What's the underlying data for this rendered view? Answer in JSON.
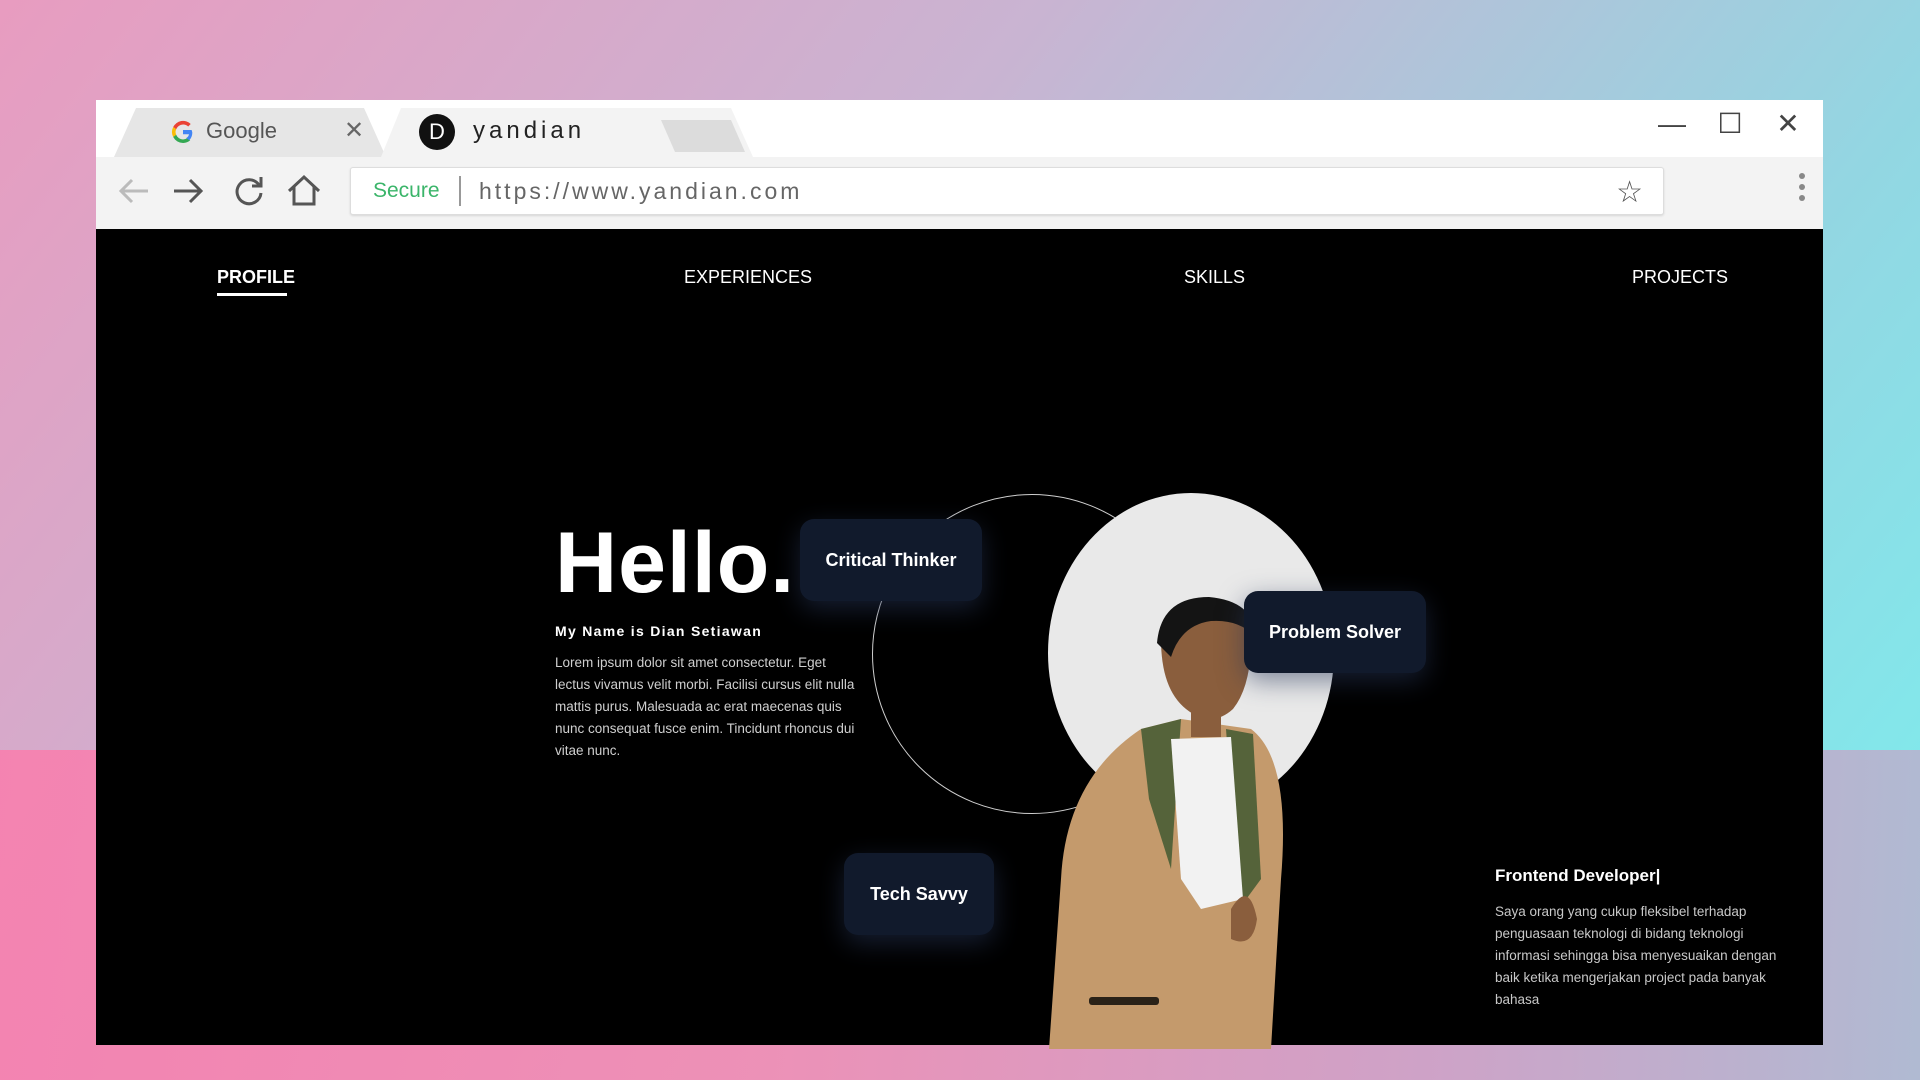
{
  "browser": {
    "tabs": [
      {
        "label": "Google",
        "close": "✕"
      },
      {
        "label": "yandian",
        "icon_letter": "D",
        "close": "✕"
      }
    ],
    "window_controls": {
      "minimize": "—",
      "maximize": "☐",
      "close": "✕"
    },
    "address": {
      "secure_label": "Secure",
      "url": "https://www.yandian.com"
    }
  },
  "nav": {
    "items": [
      "PROFILE",
      "EXPERIENCES",
      "SKILLS",
      "PROJECTS"
    ],
    "active": "PROFILE"
  },
  "hero": {
    "greeting": "Hello.",
    "name_line": "My Name is Dian Setiawan",
    "intro": "Lorem ipsum dolor sit amet consectetur. Eget lectus vivamus velit morbi. Facilisi cursus elit nulla mattis purus. Malesuada ac erat maecenas quis nunc consequat fusce enim. Tincidunt rhoncus dui vitae nunc."
  },
  "chips": [
    "Critical Thinker",
    "Problem Solver",
    "Tech Savvy"
  ],
  "role": {
    "title": "Frontend Developer|",
    "description": "Saya orang yang cukup fleksibel terhadap penguasaan teknologi di bidang teknologi informasi sehingga bisa menyesuaikan dengan baik ketika mengerjakan project pada banyak bahasa"
  },
  "icons": [
    "google-icon",
    "back-arrow-icon",
    "forward-arrow-icon",
    "reload-icon",
    "home-icon",
    "star-icon",
    "kebab-menu-icon"
  ],
  "colors": {
    "accent_chip": "#111a2c",
    "secure_green": "#3bb56a",
    "page_bg": "#000000"
  }
}
